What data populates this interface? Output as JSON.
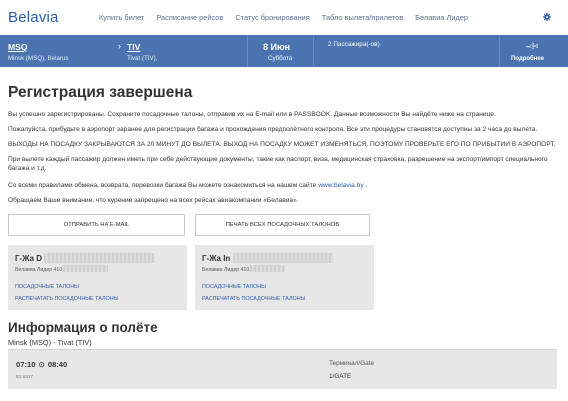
{
  "header": {
    "logo": "Belavia",
    "nav": [
      "Купить билет",
      "Расписание рейсов",
      "Статус бронирования",
      "Табло вылета/прилетов",
      "Белавиа Лидер"
    ]
  },
  "flight_bar": {
    "from_code": "MSQ",
    "from_city": "Minsk (MSQ), Belarus",
    "arrow": "›",
    "to_code": "TIV",
    "to_city": "Tivat (TIV),",
    "date": "8 Июн",
    "weekday": "Суббота",
    "passengers": "2 Пассажира(-ов)",
    "details": "Подробнее"
  },
  "main": {
    "title": "Регистрация завершена",
    "paragraphs": [
      "Вы успешно зарегистрированы. Сохраните посадочные талоны, отправив их на E-mail или в PASSBOOK. Данные возможности Вы найдёте ниже на странице.",
      "Пожалуйста, прибудьте в аэропорт заранее для регистрации багажа и прохождения предполётного контроля. Все эти процедуры становятся доступны за 2 часа до вылета.",
      "ВЫХОДЫ НА ПОСАДКУ ЗАКРЫВАЮТСЯ ЗА 20 МИНУТ ДО ВЫЛЕТА. ВЫХОД НА ПОСАДКУ МОЖЕТ ИЗМЕНЯТЬСЯ, ПОЭТОМУ ПРОВЕРЬТЕ ЕГО ПО ПРИБЫТИИ В АЭРОПОРТ.",
      "При вылете каждый пассажир должен иметь при себе действующие документы, такие как паспорт, виза, медицинская страховка, разрешение на экспорт/импорт специального багажа и т.д."
    ],
    "rules_text": "Со всеми правилами обмена, возврата, перевозки багажа Вы можете ознакомиться на нашем сайте ",
    "rules_link": "www.belavia.by",
    "rules_end": " .",
    "smoking_notice": "Обращаем Ваше внимание, что курение запрещено на всех рейсах авиакомпании «Белавиа».",
    "btn_email": "ОТПРАВИТЬ НА E-MAIL",
    "btn_print_all": "ПЕЧАТЬ ВСЕХ ПОСАДОЧНЫХ ТАЛОНОВ"
  },
  "passengers": [
    {
      "name": "Г-Жа D",
      "loyalty": "Белавиа Лидер 410",
      "link_passes": "ПОСАДОЧНЫЕ ТАЛОНЫ",
      "link_print": "РАСПЕЧАТАТЬ ПОСАДОЧНЫЕ ТАЛОНЫ"
    },
    {
      "name": "Г-Жа In",
      "loyalty": "Белавиа Лидер 410",
      "link_passes": "ПОСАДОЧНЫЕ ТАЛОНЫ",
      "link_print": "РАСПЕЧАТАТЬ ПОСАДОЧНЫЕ ТАЛОНЫ"
    }
  ],
  "flight_info": {
    "title": "Информация о полёте",
    "route": "Minsk (MSQ) - Tivat (TIV)",
    "depart": "07:10",
    "arrow": "⊙",
    "arrive": "08:40",
    "flight_code": "B2 8317",
    "terminal_label": "Терминал/Gate",
    "terminal_value": "1/GATE"
  },
  "colors": {
    "brand_blue": "#4a73b0",
    "link_blue": "#2d5aa6",
    "card_gray": "#e7e7e7"
  },
  "icons": {
    "settings": "gear-icon",
    "details": "airplane-icon"
  }
}
